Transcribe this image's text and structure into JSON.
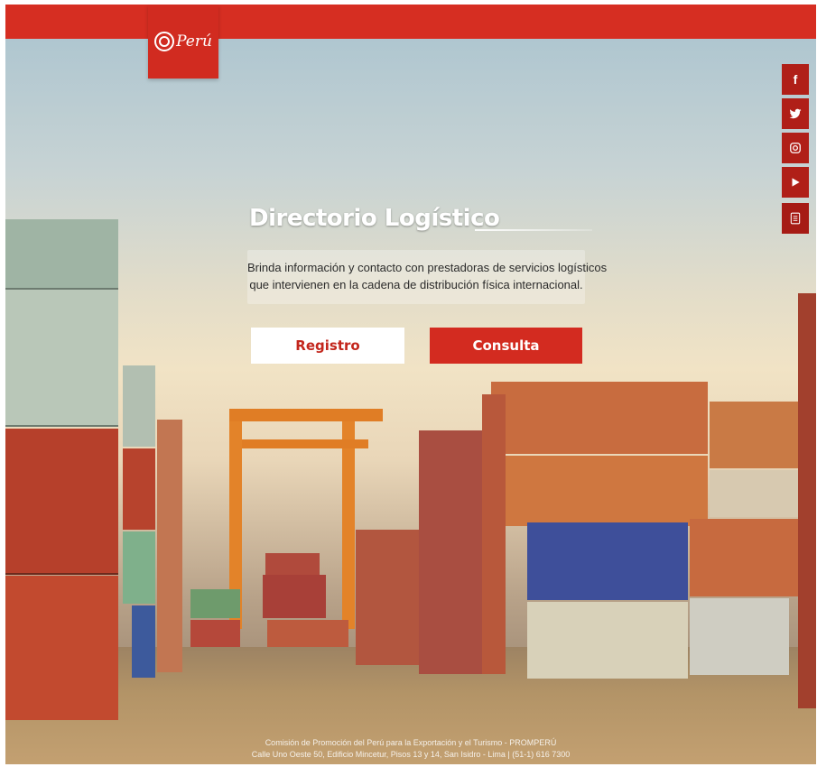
{
  "logo": {
    "text": "Perú"
  },
  "social": [
    {
      "icon": "facebook-icon",
      "glyph": "f"
    },
    {
      "icon": "twitter-icon",
      "glyph": ""
    },
    {
      "icon": "instagram-icon",
      "glyph": ""
    },
    {
      "icon": "youtube-icon",
      "glyph": ""
    },
    {
      "icon": "survey-icon",
      "glyph": ""
    }
  ],
  "hero": {
    "title": "Directorio Logístico",
    "description_line1": "Brinda información y contacto con prestadoras de servicios logísticos",
    "description_line2": "que intervienen en la cadena de distribución física internacional."
  },
  "buttons": {
    "registro": "Registro",
    "consulta": "Consulta"
  },
  "footer": {
    "line1": "Comisión de Promoción del Perú para la Exportación y el Turismo - PROMPERÚ",
    "line2": "Calle Uno Oeste 50, Edificio Mincetur, Pisos 13 y 14, San Isidro - Lima | (51-1) 616 7300"
  },
  "colors": {
    "brand_red": "#d62e22",
    "dark_red": "#b01f18"
  }
}
